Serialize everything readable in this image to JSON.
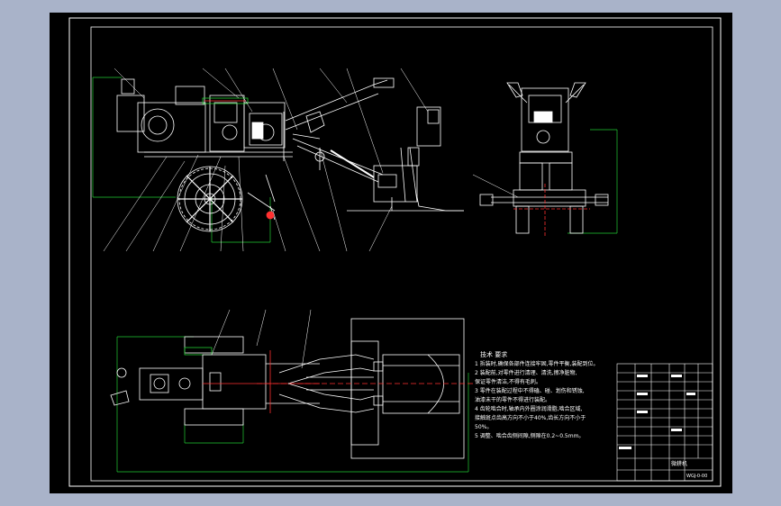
{
  "drawing": {
    "tech_req_title": "技术 要求",
    "tech_req_lines": [
      "1 拆装时,确保各部件连接牢固,零件平衡,装配到位。",
      "2 装配前,对零件进行清理、清洗,擦净脏物,",
      "  保证零件清洁,不得有毛刺。",
      "3 零件在装配过程中不得磕、碰、划伤和锈蚀,",
      "  油漆未干的零件不得进行装配。",
      "4 齿轮啮合时,轴承内外圈涂润滑脂,啮合区域,",
      "  接触斑点齿高方向不小于40%,齿长方向不小于",
      "  50%。",
      "5 调整、啮合齿侧间隙,侧隙在0.2~0.5mm。"
    ],
    "title_block": {
      "name": "微耕机",
      "drawing_no": "WGJ-0-00"
    }
  },
  "colors": {
    "background": "#a9b3c9",
    "sheet": "#000000",
    "linework": "#ffffff",
    "dimension": "#22cc33",
    "center_line": "#ff3030",
    "text": "#ffffff"
  }
}
